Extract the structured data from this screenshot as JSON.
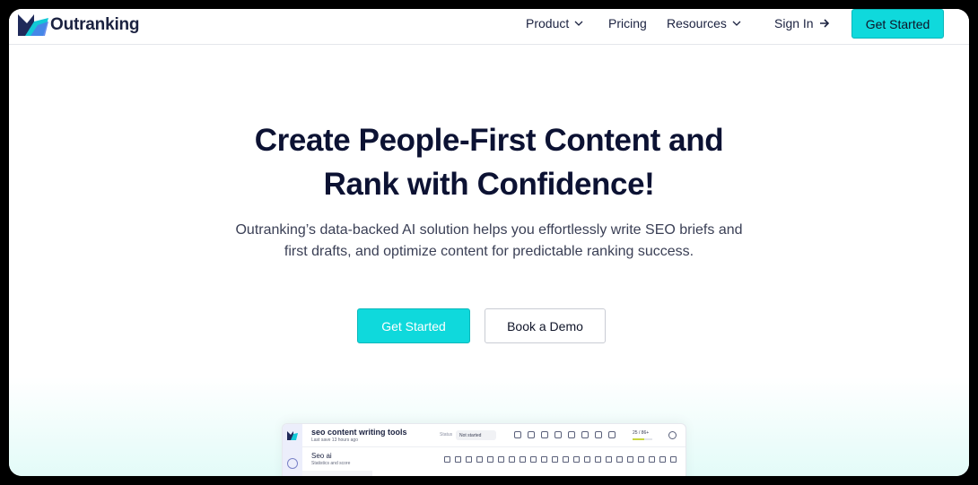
{
  "brand": {
    "name": "Outranking",
    "accent": "#0fd9dc",
    "text_color": "#0c1233"
  },
  "nav": {
    "items": [
      {
        "label": "Product",
        "dropdown": true
      },
      {
        "label": "Pricing",
        "dropdown": false
      },
      {
        "label": "Resources",
        "dropdown": true
      }
    ],
    "sign_in": "Sign In",
    "get_started": "Get Started"
  },
  "hero": {
    "title_line1": "Create People-First Content and",
    "title_line2": "Rank with Confidence!",
    "subtitle_line1": "Outranking’s data-backed AI solution helps you effortlessly write SEO briefs and",
    "subtitle_line2": "first drafts, and optimize content for predictable ranking success.",
    "primary_cta": "Get Started",
    "secondary_cta": "Book a Demo"
  },
  "preview": {
    "doc_title": "seo content writing tools",
    "last_save": "Last save 13 hours ago",
    "status_label": "Status",
    "status_value": "Not started",
    "score": "25 / 86+",
    "score_fraction": 0.6,
    "panel_title": "Seo ai",
    "panel_subtitle": "Statistics and score"
  }
}
